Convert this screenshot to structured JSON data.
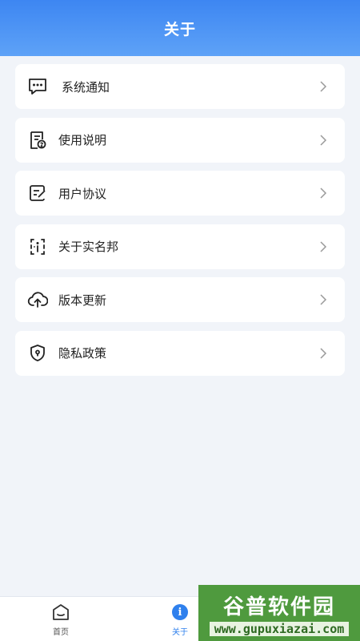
{
  "header": {
    "title": "关于"
  },
  "menu": {
    "items": [
      {
        "label": "系统通知",
        "icon": "message-icon"
      },
      {
        "label": "使用说明",
        "icon": "document-help-icon"
      },
      {
        "label": "用户协议",
        "icon": "edit-document-icon"
      },
      {
        "label": "关于实名邦",
        "icon": "info-box-icon"
      },
      {
        "label": "版本更新",
        "icon": "cloud-upload-icon"
      },
      {
        "label": "隐私政策",
        "icon": "shield-icon"
      }
    ]
  },
  "tabbar": {
    "items": [
      {
        "label": "首页",
        "icon": "home-icon",
        "active": false
      },
      {
        "label": "关于",
        "icon": "info-icon",
        "active": true,
        "icon_text": "i"
      }
    ],
    "active_color": "#2f80ed"
  },
  "watermark": {
    "title": "谷普软件园",
    "url": "www.gupuxiazai.com"
  }
}
